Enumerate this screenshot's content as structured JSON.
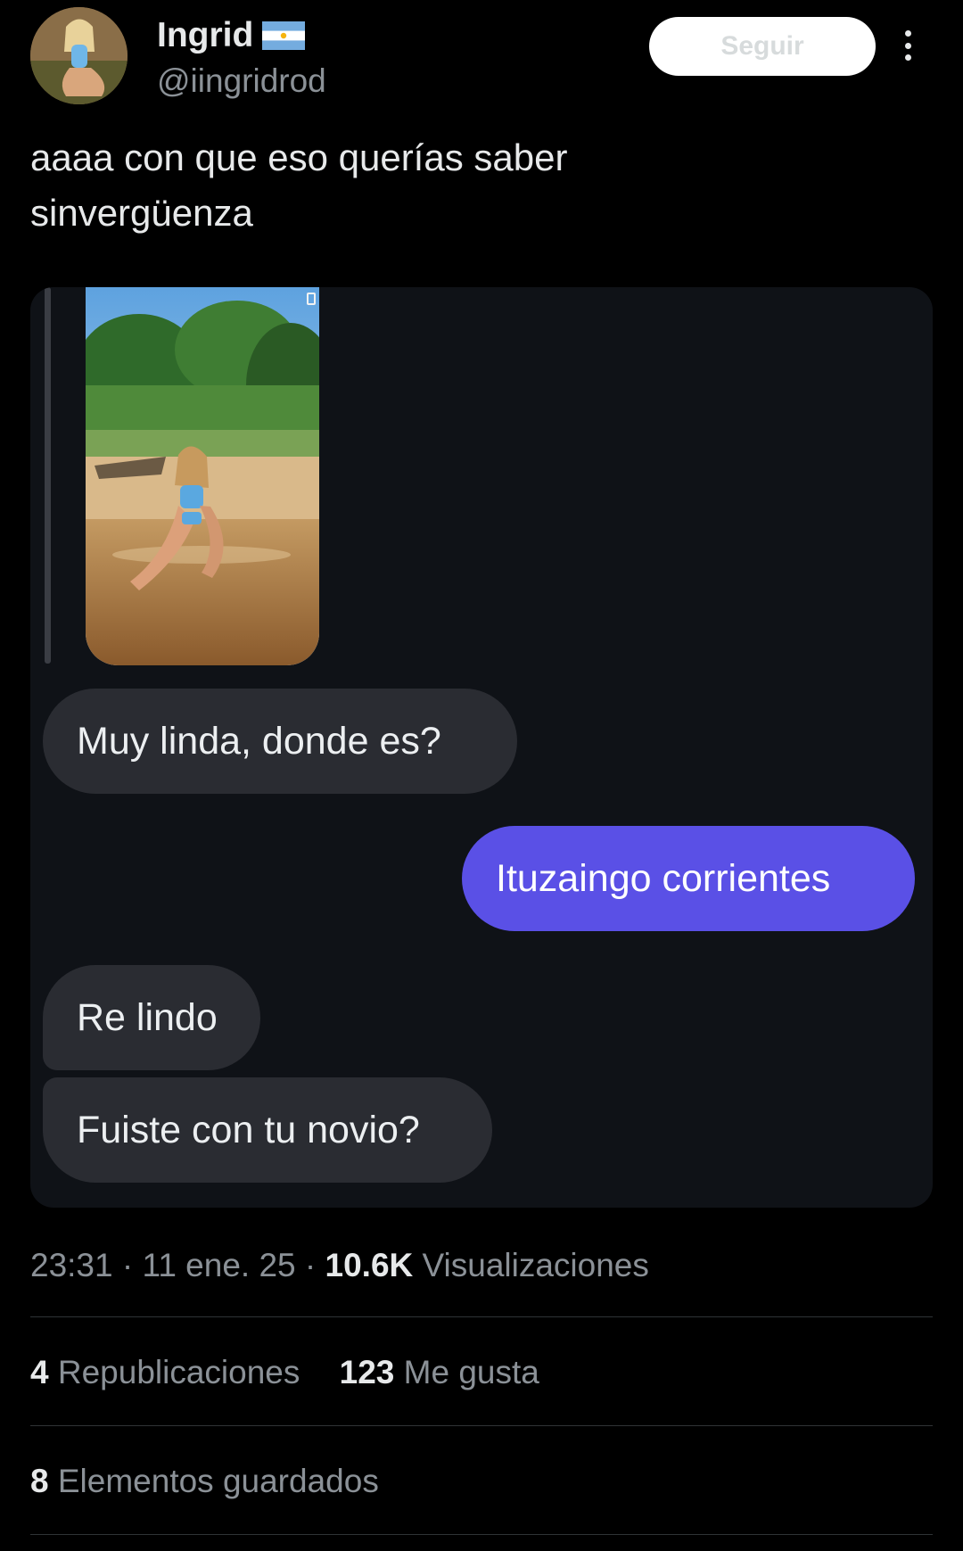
{
  "author": {
    "display_name": "Ingrid",
    "handle": "@iingridrod",
    "flag_icon": "argentina-flag-icon",
    "avatar_icon": "profile-photo-avatar"
  },
  "follow_button": {
    "label": "Seguir"
  },
  "more_icon": "vertical-ellipsis-icon",
  "tweet": {
    "text_line1": "aaaa con que eso querías saber",
    "text_line2": "sinvergüenza"
  },
  "chat": {
    "photo_icon": "beach-photo-image",
    "messages": [
      {
        "side": "in",
        "text": "Muy linda, donde es?"
      },
      {
        "side": "out",
        "text": "Ituzaingo corrientes"
      },
      {
        "side": "in",
        "text": "Re lindo"
      },
      {
        "side": "in",
        "text": "Fuiste con tu novio?"
      }
    ],
    "colors": {
      "incoming": "#2a2c32",
      "outgoing": "#5a50e6",
      "card": "#0f1217"
    }
  },
  "meta": {
    "time": "23:31",
    "separator": "·",
    "date": "11 ene. 25",
    "views_count": "10.6K",
    "views_label": "Visualizaciones"
  },
  "stats": {
    "reposts_count": "4",
    "reposts_label": "Republicaciones",
    "likes_count": "123",
    "likes_label": "Me gusta",
    "bookmarks_count": "8",
    "bookmarks_label": "Elementos guardados"
  }
}
